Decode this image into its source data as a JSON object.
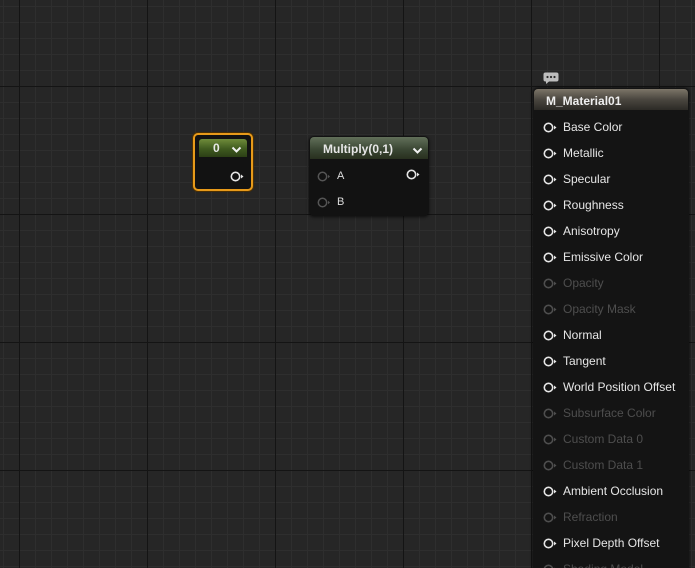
{
  "constant_node": {
    "value": "0",
    "collapse_icon": "chevron-down-icon",
    "output_pin_icon": "pin-output-icon"
  },
  "multiply_node": {
    "title": "Multiply(0,1)",
    "inputs": [
      "A",
      "B"
    ],
    "collapse_icon": "chevron-down-icon"
  },
  "material_node": {
    "title": "M_Material01",
    "comment_icon": "comment-bubble-icon",
    "inputs": [
      {
        "label": "Base Color",
        "enabled": true
      },
      {
        "label": "Metallic",
        "enabled": true
      },
      {
        "label": "Specular",
        "enabled": true
      },
      {
        "label": "Roughness",
        "enabled": true
      },
      {
        "label": "Anisotropy",
        "enabled": true
      },
      {
        "label": "Emissive Color",
        "enabled": true
      },
      {
        "label": "Opacity",
        "enabled": false
      },
      {
        "label": "Opacity Mask",
        "enabled": false
      },
      {
        "label": "Normal",
        "enabled": true
      },
      {
        "label": "Tangent",
        "enabled": true
      },
      {
        "label": "World Position Offset",
        "enabled": true
      },
      {
        "label": "Subsurface Color",
        "enabled": false
      },
      {
        "label": "Custom Data 0",
        "enabled": false
      },
      {
        "label": "Custom Data 1",
        "enabled": false
      },
      {
        "label": "Ambient Occlusion",
        "enabled": true
      },
      {
        "label": "Refraction",
        "enabled": false
      },
      {
        "label": "Pixel Depth Offset",
        "enabled": true
      },
      {
        "label": "Shading Model",
        "enabled": false
      }
    ]
  },
  "colors": {
    "selection_outline": "#e79a1a",
    "constant_header": "#4f6a28",
    "multiply_header": "#4a5642",
    "material_header": "#5a554c",
    "pin_enabled": "#e6e6e6",
    "pin_disabled": "#4e4e4e",
    "graph_background": "#262626"
  }
}
